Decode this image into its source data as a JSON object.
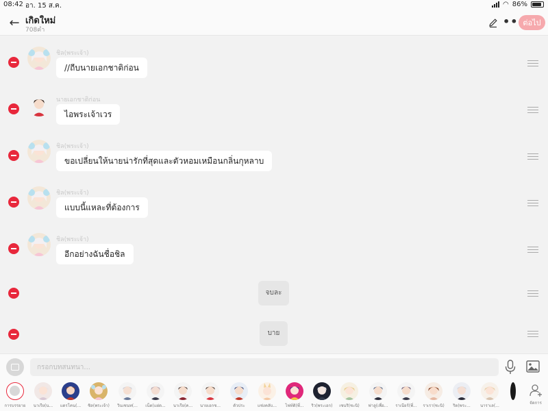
{
  "status_bar": {
    "time": "08:42",
    "date": "อา. 15 ส.ค.",
    "battery": "86%"
  },
  "header": {
    "title": "เกิดใหม่",
    "subtitle": "708คำ",
    "next_label": "ต่อไป",
    "accent_color": "#f6a9ad"
  },
  "messages": [
    {
      "type": "dialogue",
      "sender": "ชิล(พระเจ้า)",
      "text": "//ถีบนายเอกชาติก่อน"
    },
    {
      "type": "dialogue",
      "sender": "นายเอกชาติก่อน",
      "text": "ไอพระเจ้าเวร"
    },
    {
      "type": "dialogue",
      "sender": "ชิล(พระเจ้า)",
      "text": "ขอเปลี่ยนให้นายน่ารักที่สุดและตัวหอมเหมือนกลิ่นกุหลาบ"
    },
    {
      "type": "dialogue",
      "sender": "ชิล(พระเจ้า)",
      "text": "แบบนี้แหละที่ต้องการ"
    },
    {
      "type": "dialogue",
      "sender": "ชิล(พระเจ้า)",
      "text": "อีกอย่างฉันชื่อชิล"
    },
    {
      "type": "narration",
      "text": "จบละ"
    },
    {
      "type": "narration",
      "text": "บาย"
    }
  ],
  "composer": {
    "placeholder": "กรอกบทสนทนา..."
  },
  "characters": [
    {
      "label": "การบรรยาย"
    },
    {
      "label": "นาเรีย(น..."
    },
    {
      "label": "แดรโคน(..."
    },
    {
      "label": "ชิล(พระเจ้า)"
    },
    {
      "label": "วินเซนท(..."
    },
    {
      "label": "เน็ต(แฝด..."
    },
    {
      "label": "นาเรีย(ค..."
    },
    {
      "label": "นายเอกช..."
    },
    {
      "label": "ตัวประ"
    },
    {
      "label": "แซ่งคลับ..."
    },
    {
      "label": "ไฟท์ติ(พี่..."
    },
    {
      "label": "ริว(พระเอก)"
    },
    {
      "label": "เซนริ(ซะนิ)"
    },
    {
      "label": "ฟาลู(เพื่อ..."
    },
    {
      "label": "ราเนียร์(พี่..."
    },
    {
      "label": "ราเรา(ซะนิ)"
    },
    {
      "label": "ริต(พระ..."
    },
    {
      "label": "นาราเล(..."
    }
  ],
  "manage_label": "จัดการ",
  "colors": {
    "delete": "#e8283c",
    "bubble": "#ffffff",
    "narration_bubble": "#e6e6e6",
    "background": "#f2f2f2"
  }
}
